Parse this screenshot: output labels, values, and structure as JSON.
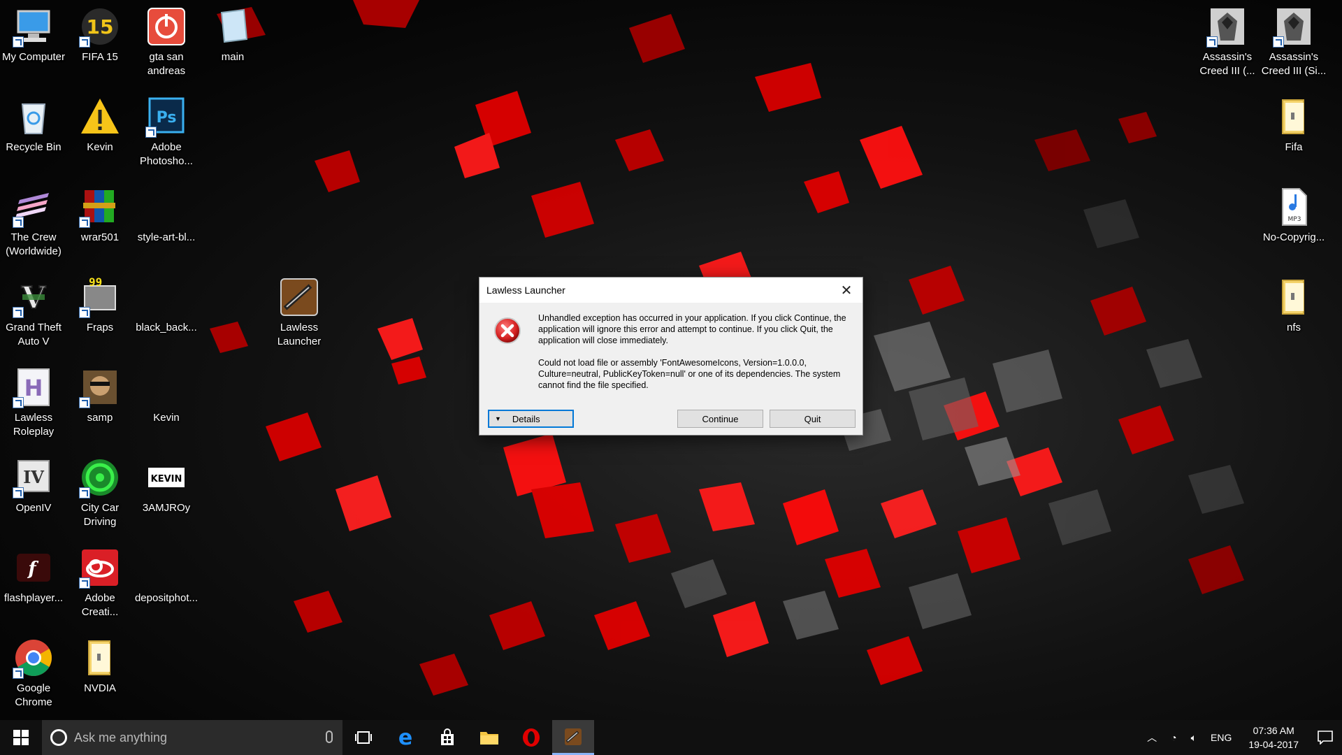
{
  "desktop": {
    "icons": [
      {
        "label": "My Computer",
        "icon": "computer-icon"
      },
      {
        "label": "FIFA 15",
        "icon": "fifa-icon"
      },
      {
        "label": "gta san andreas",
        "icon": "power-icon"
      },
      {
        "label": "main",
        "icon": "document-icon"
      },
      {
        "label": "Recycle Bin",
        "icon": "recycle-bin-icon"
      },
      {
        "label": "Kevin",
        "icon": "warning-icon"
      },
      {
        "label": "Adobe Photosho...",
        "icon": "photoshop-icon"
      },
      {
        "label": "The Crew (Worldwide)",
        "icon": "crew-icon"
      },
      {
        "label": "wrar501",
        "icon": "winrar-icon"
      },
      {
        "label": "style-art-bl...",
        "icon": "image-icon"
      },
      {
        "label": "Grand Theft Auto V",
        "icon": "gta-v-icon"
      },
      {
        "label": "Fraps",
        "icon": "fraps-icon"
      },
      {
        "label": "black_back...",
        "icon": "image-icon"
      },
      {
        "label": "Lawless Launcher",
        "icon": "shotgun-icon"
      },
      {
        "label": "Lawless Roleplay",
        "icon": "lawless-h-icon"
      },
      {
        "label": "samp",
        "icon": "samp-icon"
      },
      {
        "label": "Kevin",
        "icon": "blank-icon"
      },
      {
        "label": "OpenIV",
        "icon": "openiv-icon"
      },
      {
        "label": "City Car Driving",
        "icon": "city-car-icon"
      },
      {
        "label": "3AMJROy",
        "icon": "kevin-logo-icon"
      },
      {
        "label": "flashplayer...",
        "icon": "flash-icon"
      },
      {
        "label": "Adobe Creati...",
        "icon": "creative-cloud-icon"
      },
      {
        "label": "depositphot...",
        "icon": "image-icon"
      },
      {
        "label": "Google Chrome",
        "icon": "chrome-icon"
      },
      {
        "label": "NVDIA",
        "icon": "folder-icon"
      },
      {
        "label": "Assassin's Creed III (...",
        "icon": "assassin-icon"
      },
      {
        "label": "Assassin's Creed III (Si...",
        "icon": "assassin-icon"
      },
      {
        "label": "Fifa",
        "icon": "folder-icon"
      },
      {
        "label": "No-Copyrig...",
        "icon": "mp3-icon"
      },
      {
        "label": "nfs",
        "icon": "folder-icon"
      }
    ]
  },
  "dialog": {
    "title": "Lawless Launcher",
    "message1": "Unhandled exception has occurred in your application. If you click Continue, the application will ignore this error and attempt to continue. If you click Quit, the application will close immediately.",
    "message2": "Could not load file or assembly 'FontAwesomeIcons, Version=1.0.0.0, Culture=neutral, PublicKeyToken=null' or one of its dependencies. The system cannot find the file specified.",
    "details_label": "Details",
    "continue_label": "Continue",
    "quit_label": "Quit"
  },
  "taskbar": {
    "search_placeholder": "Ask me anything",
    "language": "ENG",
    "time": "07:36 AM",
    "date": "19-04-2017"
  },
  "colors": {
    "accent": "#0078d7",
    "wallpaper_red": "#e00000",
    "error_red": "#d42020"
  }
}
